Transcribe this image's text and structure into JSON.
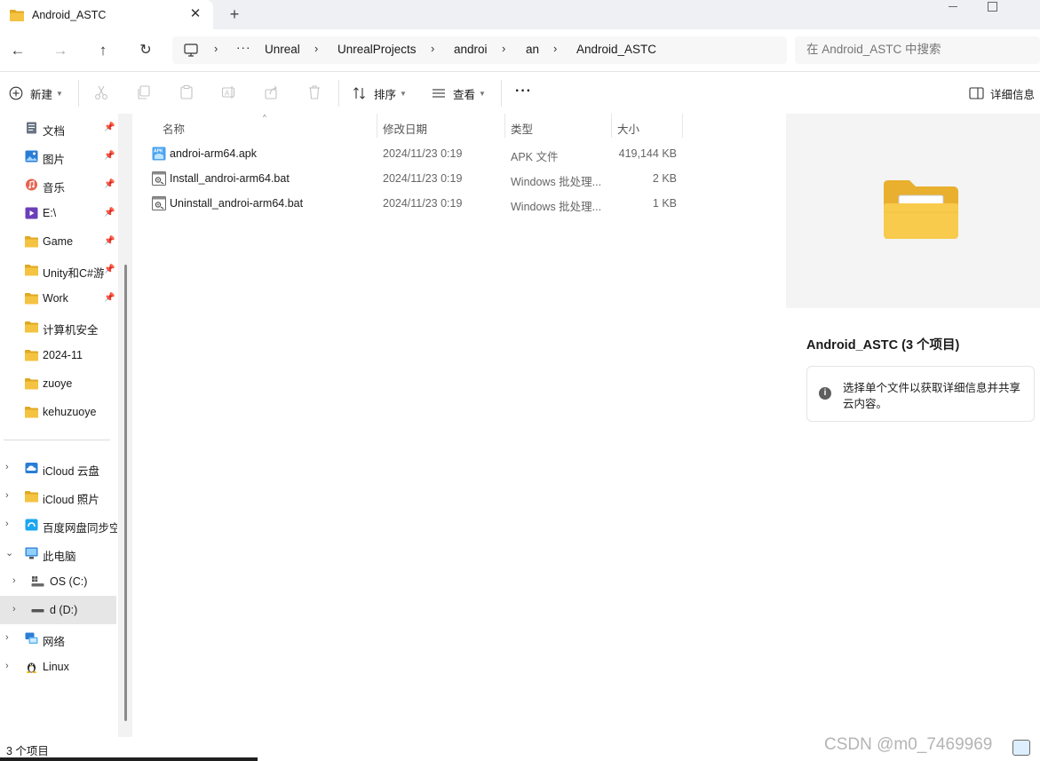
{
  "window": {
    "tab_title": "Android_ASTC",
    "close_glyph": "✕",
    "new_tab_glyph": "+"
  },
  "nav": {
    "back_glyph": "←",
    "forward_glyph": "→",
    "up_glyph": "↑",
    "refresh_glyph": "↻",
    "more_glyph": "···",
    "breadcrumb": [
      "Unreal",
      "UnrealProjects",
      "androi",
      "an",
      "Android_ASTC"
    ],
    "search_placeholder": "在 Android_ASTC 中搜索"
  },
  "toolbar": {
    "new_label": "新建",
    "sort_label": "排序",
    "view_label": "查看",
    "more_glyph": "···",
    "details_label": "详细信息"
  },
  "sidebar": {
    "items": [
      {
        "label": "文档",
        "icon": "documents-icon",
        "pinned": true
      },
      {
        "label": "图片",
        "icon": "pictures-icon",
        "pinned": true
      },
      {
        "label": "音乐",
        "icon": "music-icon",
        "pinned": true
      },
      {
        "label": "E:\\",
        "icon": "video-folder-icon",
        "pinned": true
      },
      {
        "label": "Game",
        "icon": "folder-icon",
        "pinned": true
      },
      {
        "label": "Unity和C#游",
        "icon": "folder-icon",
        "pinned": true
      },
      {
        "label": "Work",
        "icon": "folder-icon",
        "pinned": true
      },
      {
        "label": "计算机安全",
        "icon": "folder-icon",
        "pinned": false
      },
      {
        "label": "2024-11",
        "icon": "folder-icon",
        "pinned": false
      },
      {
        "label": "zuoye",
        "icon": "folder-icon",
        "pinned": false
      },
      {
        "label": "kehuzuoye",
        "icon": "folder-icon",
        "pinned": false
      }
    ],
    "tree": [
      {
        "label": "iCloud 云盘",
        "icon": "icloud-icon",
        "indent": 0,
        "expander": "›"
      },
      {
        "label": "iCloud 照片",
        "icon": "folder-icon",
        "indent": 0,
        "expander": "›"
      },
      {
        "label": "百度网盘同步空",
        "icon": "baidu-netdisk-icon",
        "indent": 0,
        "expander": "›"
      },
      {
        "label": "此电脑",
        "icon": "this-pc-icon",
        "indent": 0,
        "expander": "⌄"
      },
      {
        "label": "OS (C:)",
        "icon": "drive-os-icon",
        "indent": 1,
        "expander": "›"
      },
      {
        "label": "d (D:)",
        "icon": "drive-icon",
        "indent": 1,
        "expander": "›",
        "selected": true
      },
      {
        "label": "网络",
        "icon": "network-icon",
        "indent": 0,
        "expander": "›"
      },
      {
        "label": "Linux",
        "icon": "linux-icon",
        "indent": 0,
        "expander": "›"
      }
    ]
  },
  "filelist": {
    "columns": {
      "name": "名称",
      "date": "修改日期",
      "type": "类型",
      "size": "大小"
    },
    "rows": [
      {
        "name": "androi-arm64.apk",
        "date": "2024/11/23 0:19",
        "type": "APK 文件",
        "size": "419,144 KB",
        "icon": "apk-file-icon"
      },
      {
        "name": "Install_androi-arm64.bat",
        "date": "2024/11/23 0:19",
        "type": "Windows 批处理...",
        "size": "2 KB",
        "icon": "bat-file-icon"
      },
      {
        "name": "Uninstall_androi-arm64.bat",
        "date": "2024/11/23 0:19",
        "type": "Windows 批处理...",
        "size": "1 KB",
        "icon": "bat-file-icon"
      }
    ]
  },
  "details": {
    "title": "Android_ASTC (3 个项目)",
    "info_text": "选择单个文件以获取详细信息并共享云内容。",
    "info_glyph": "i"
  },
  "status": {
    "item_count": "3 个项目",
    "watermark": "CSDN @m0_7469969"
  },
  "colors": {
    "folder_yellow": "#f5c342",
    "folder_dark": "#e0a922",
    "selection": "#e6e6e6",
    "accent_blue": "#2a7dd6"
  }
}
